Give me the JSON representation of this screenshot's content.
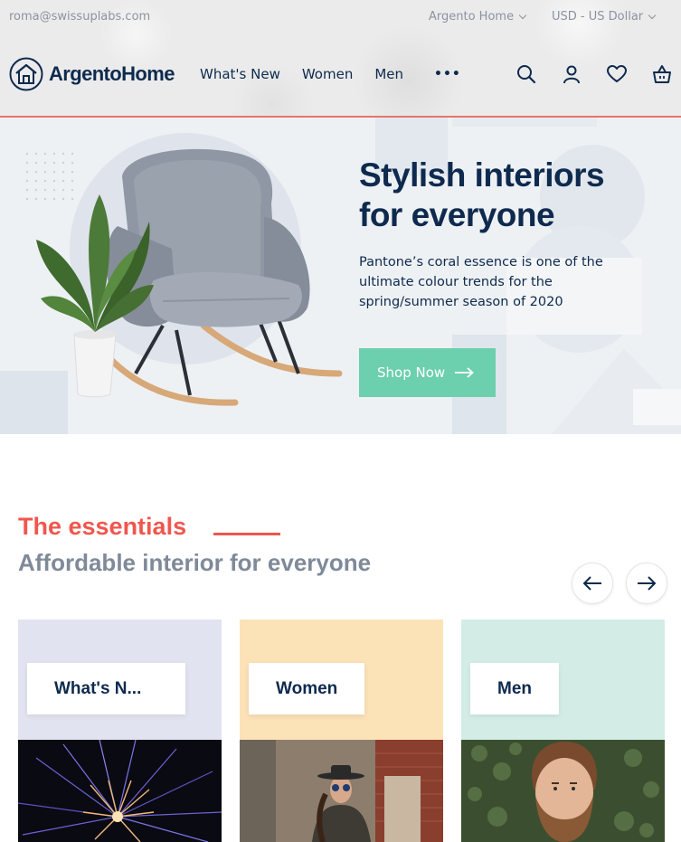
{
  "topbar": {
    "email": "roma@swissuplabs.com",
    "store": "Argento Home",
    "currency": "USD - US Dollar"
  },
  "header": {
    "logo_text": "ArgentoHome",
    "nav": [
      "What's New",
      "Women",
      "Men"
    ],
    "more_label": "•••",
    "icons": [
      "search-icon",
      "account-icon",
      "wishlist-icon",
      "cart-icon"
    ]
  },
  "hero": {
    "title_line1": "Stylish interiors",
    "title_line2": "for everyone",
    "description": "Pantone’s coral essence is one of the ultimate colour trends for the spring/summer season of 2020",
    "button_label": "Shop Now"
  },
  "essentials": {
    "title": "The essentials",
    "subtitle": "Affordable interior for everyone",
    "cards": [
      {
        "label": "What's N...",
        "color": "#e1e3f0"
      },
      {
        "label": "Women",
        "color": "#fbe2b7"
      },
      {
        "label": "Men",
        "color": "#d3ede6"
      }
    ]
  },
  "colors": {
    "brand_navy": "#0e2a4e",
    "accent_coral": "#f0564e",
    "button_mint": "#6ccfae"
  }
}
